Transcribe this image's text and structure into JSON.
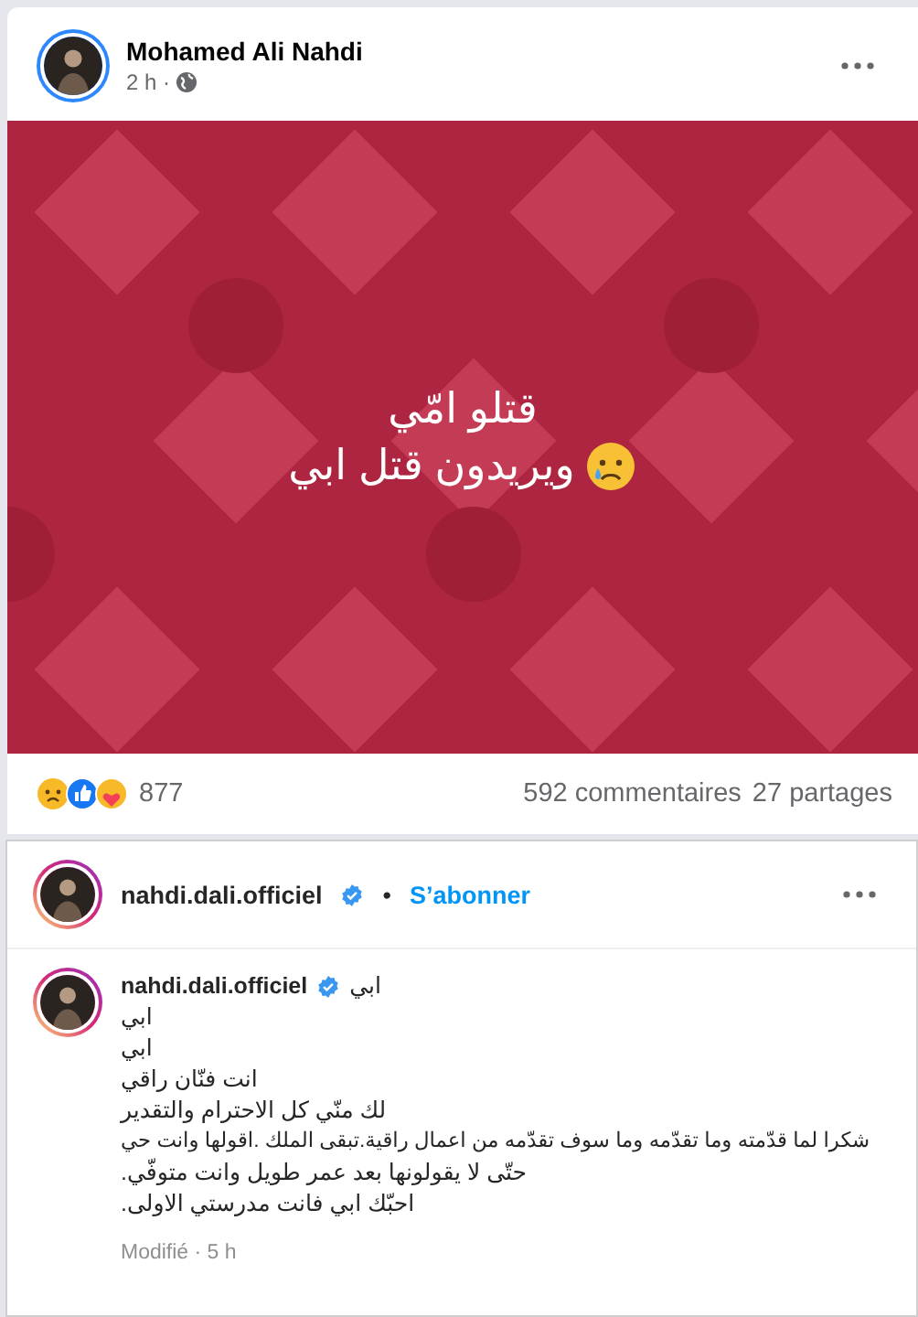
{
  "post": {
    "author": "Mohamed Ali Nahdi",
    "time": "2 h ·",
    "image": {
      "kind": "picture",
      "lines": [
        "قتلو امّي",
        "ويريدون قتل ابي"
      ]
    },
    "reactions_count": "877",
    "comments": "592 commentaires",
    "shares": "27 partages"
  },
  "instagram": {
    "username": "nahdi.dali.officiel",
    "verified": true,
    "separator": "•",
    "follow": "S’abonner",
    "caption_username": "nahdi.dali.officiel",
    "caption_verified": true,
    "caption_lines": [
      "ابي",
      "ابي",
      "ابي",
      "انت فنّان راقي",
      "لك منّي كل الاحترام والتقدير",
      "شكرا لما قدّمته وما تقدّمه وما سوف تقدّمه من اعمال راقية.تبقى الملك .اقولها وانت حي",
      "حتّى لا يقولونها بعد عمر طويل وانت متوفّي.",
      "احبّك ابي فانت مدرستي الاولى."
    ],
    "meta": "Modifié · 5 h"
  }
}
